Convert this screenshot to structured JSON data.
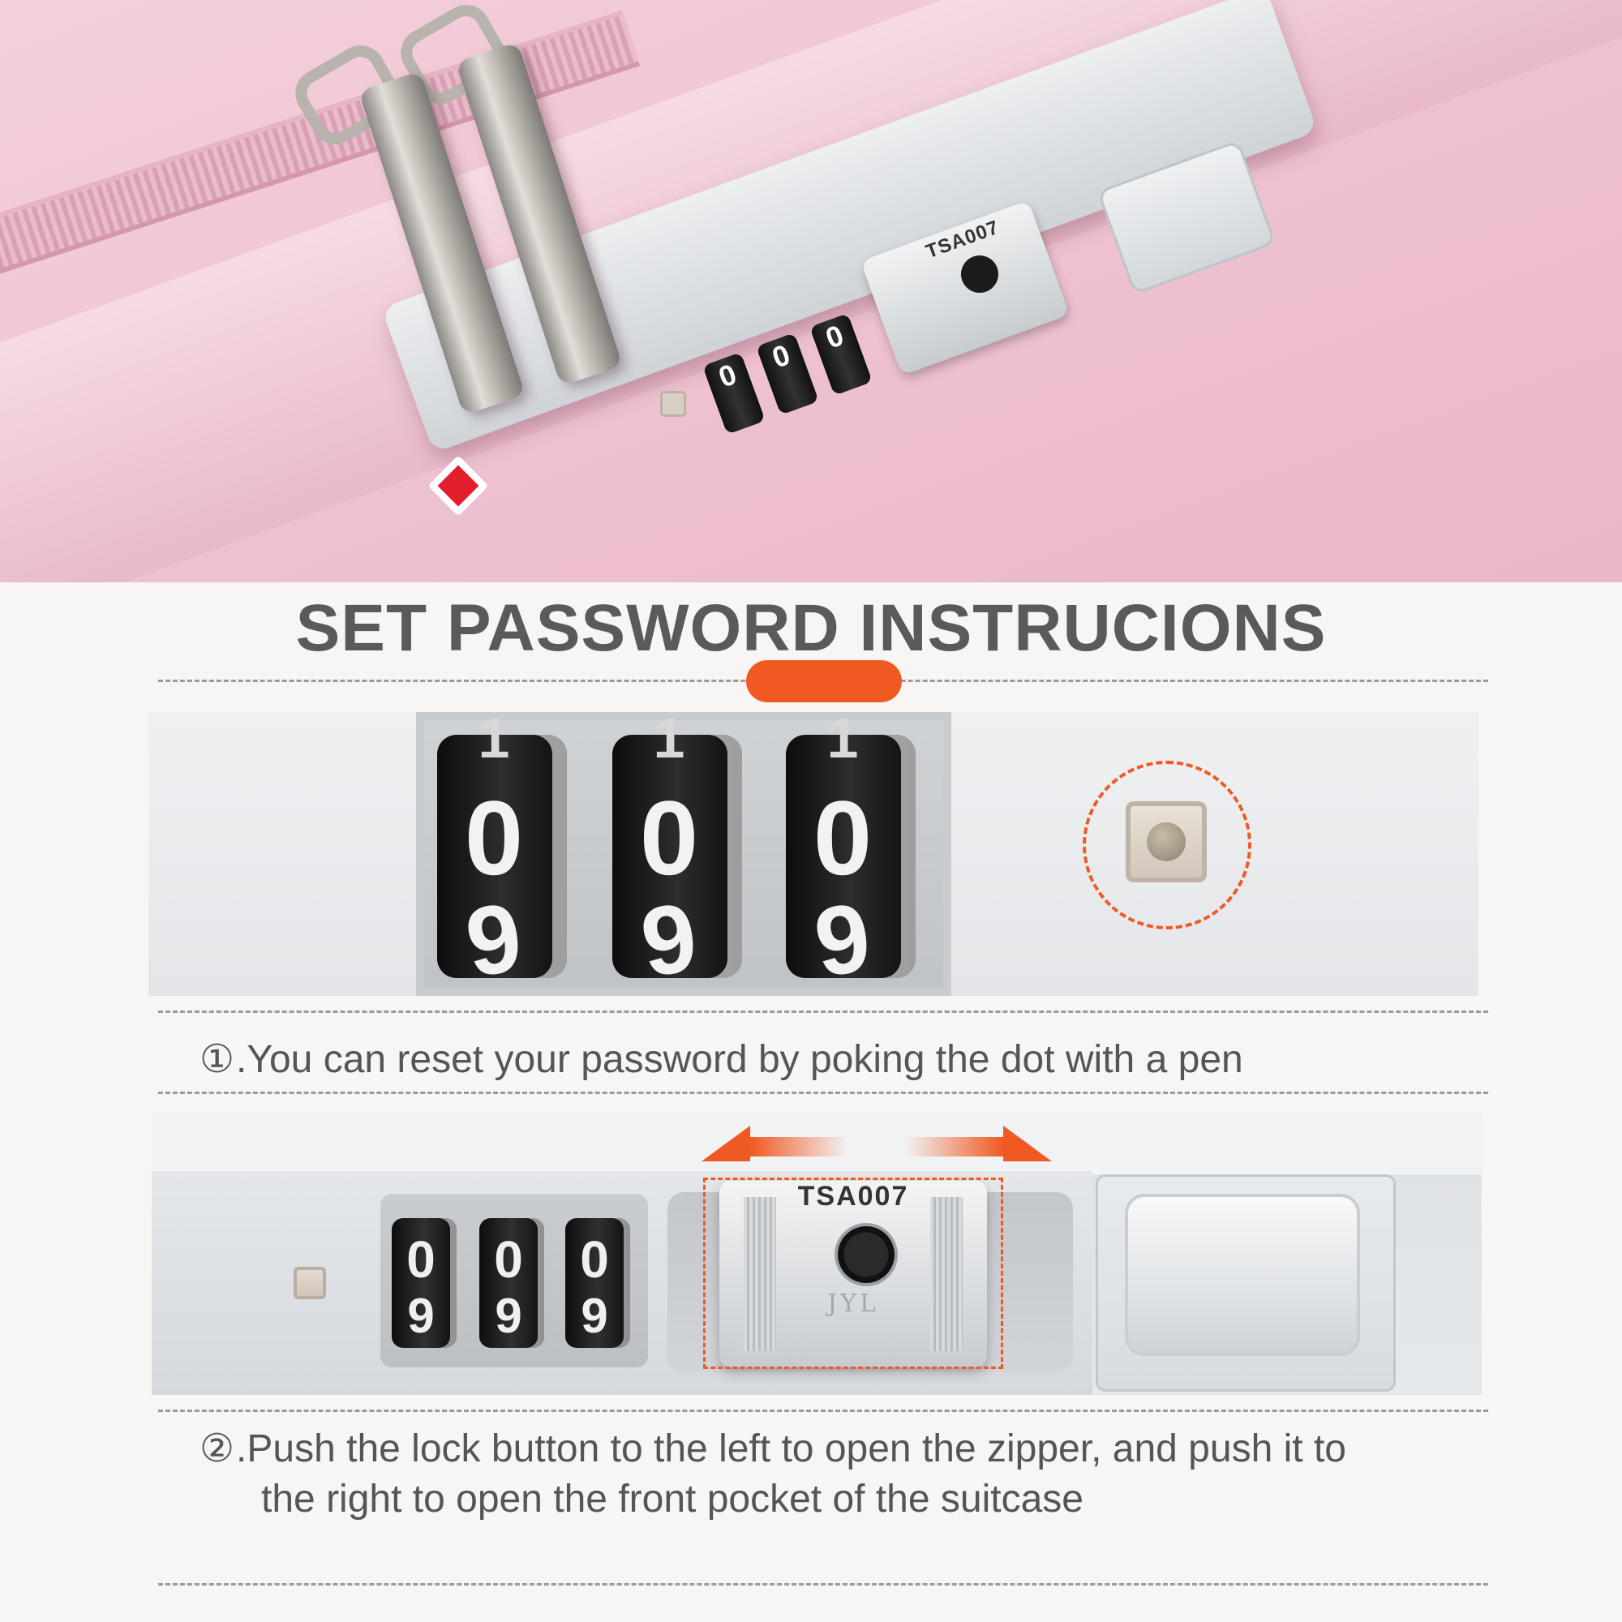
{
  "hero": {
    "tsa_label": "TSA007",
    "dial_digits": [
      "0",
      "0",
      "0"
    ],
    "logo_icon": "tsa-diamond-icon"
  },
  "title": "SET PASSWORD INSTRUCIONS",
  "colors": {
    "accent": "#f05a22",
    "title_text": "#5a5a5a",
    "body_text": "#555555",
    "suitcase_pink": "#efc3d2"
  },
  "panel1": {
    "dials": [
      {
        "top": "1",
        "mid": "0",
        "bot": "9"
      },
      {
        "top": "1",
        "mid": "0",
        "bot": "9"
      },
      {
        "top": "1",
        "mid": "0",
        "bot": "9"
      }
    ]
  },
  "steps": [
    {
      "num": "①",
      "text": ".You can reset your password by poking the dot with a pen"
    },
    {
      "num": "②",
      "text": ".Push the lock button to the left to open the zipper, and push it to",
      "text2": "the right to open the front pocket of the suitcase"
    }
  ],
  "panel2": {
    "tsa_label": "TSA007",
    "brand": "JYL",
    "dials": [
      {
        "mid": "0",
        "bot": "9"
      },
      {
        "mid": "0",
        "bot": "9"
      },
      {
        "mid": "0",
        "bot": "9"
      }
    ],
    "arrow_left_icon": "arrow-left-icon",
    "arrow_right_icon": "arrow-right-icon"
  }
}
